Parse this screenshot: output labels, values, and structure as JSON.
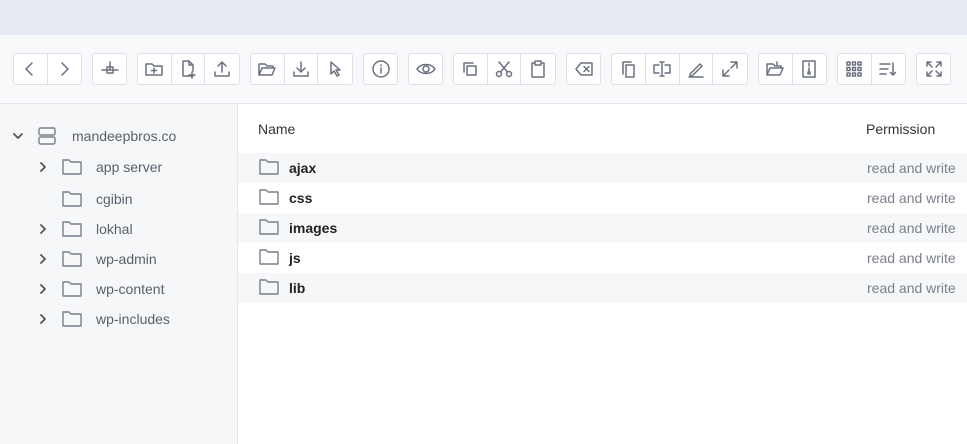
{
  "toolbar": {
    "groups": [
      [
        "chevron-left-icon",
        "chevron-right-icon"
      ],
      [
        "network-icon"
      ],
      [
        "new-folder-icon",
        "new-file-icon",
        "upload-icon"
      ],
      [
        "open-folder-icon",
        "download-icon",
        "select-pointer-icon"
      ],
      [
        "info-icon"
      ],
      [
        "eye-icon"
      ],
      [
        "copy-icon",
        "scissors-icon",
        "clipboard-icon"
      ],
      [
        "delete-icon"
      ],
      [
        "duplicate-icon",
        "rename-icon",
        "edit-icon",
        "resize-icon"
      ],
      [
        "extract-icon",
        "archive-icon"
      ],
      [
        "grid-view-icon",
        "sort-icon"
      ],
      [
        "fullscreen-icon"
      ]
    ]
  },
  "sidebar": {
    "root": {
      "label": "mandeepbros.co",
      "icon": "server-icon"
    },
    "items": [
      {
        "label": "app server",
        "expandable": true
      },
      {
        "label": "cgibin",
        "expandable": false
      },
      {
        "label": "lokhal",
        "expandable": true
      },
      {
        "label": "wp-admin",
        "expandable": true
      },
      {
        "label": "wp-content",
        "expandable": true
      },
      {
        "label": "wp-includes",
        "expandable": true
      }
    ]
  },
  "main": {
    "columns": {
      "name": "Name",
      "permission": "Permission"
    },
    "rows": [
      {
        "name": "ajax",
        "permission": "read and write"
      },
      {
        "name": "css",
        "permission": "read and write"
      },
      {
        "name": "images",
        "permission": "read and write"
      },
      {
        "name": "js",
        "permission": "read and write"
      },
      {
        "name": "lib",
        "permission": "read and write"
      }
    ]
  },
  "colors": {
    "topbar": "#e8eaf4",
    "sidebar": "#f6f7f9",
    "icon": "#6b7080"
  }
}
